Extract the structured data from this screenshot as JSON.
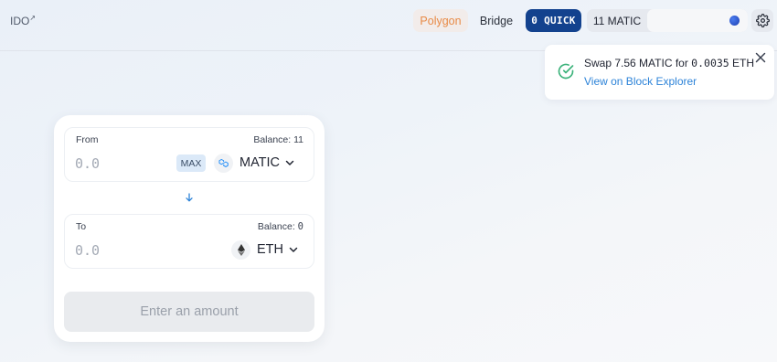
{
  "header": {
    "ido_label": "IDO",
    "ido_ext": "↗",
    "network_label": "Polygon",
    "bridge_label": "Bridge",
    "quick_balance": "0 QUICK",
    "wallet_balance": "11 MATIC",
    "colors": {
      "network": "#e88a46",
      "quick_bg": "#13428e"
    }
  },
  "toast": {
    "prefix": "Swap ",
    "from_amount": "7.56",
    "mid": " MATIC for ",
    "to_amount": "0.0035",
    "suffix": " ETH",
    "link_label": "View on Block Explorer",
    "status_icon": "check-circle-icon",
    "colors": {
      "success": "#3bb27a",
      "link": "#2d83d8"
    }
  },
  "swap": {
    "from": {
      "label": "From",
      "balance_label": "Balance: 11",
      "amount_placeholder": "0.0",
      "max_label": "MAX",
      "token": "MATIC",
      "token_icon": "matic-icon"
    },
    "to": {
      "label": "To",
      "balance_prefix": "Balance: ",
      "balance_value": "0",
      "amount_placeholder": "0.0",
      "token": "ETH",
      "token_icon": "eth-icon"
    },
    "action_label": "Enter an amount"
  }
}
